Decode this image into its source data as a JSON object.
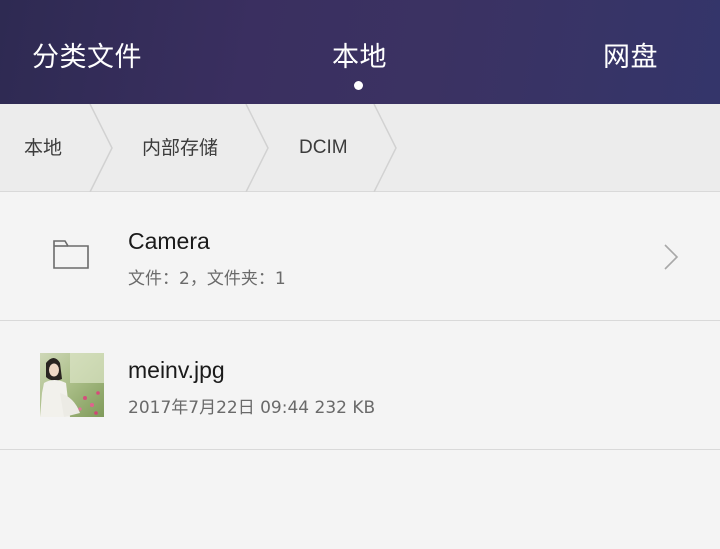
{
  "tabs": {
    "category": "分类文件",
    "local": "本地",
    "cloud": "网盘"
  },
  "breadcrumb": [
    "本地",
    "内部存储",
    "DCIM"
  ],
  "items": [
    {
      "type": "folder",
      "name": "Camera",
      "meta": "文件：2，文件夹：1",
      "icon": "folder-icon"
    },
    {
      "type": "image",
      "name": "meinv.jpg",
      "meta": "2017年7月22日 09:44 232 KB",
      "icon": "image-thumbnail"
    }
  ]
}
